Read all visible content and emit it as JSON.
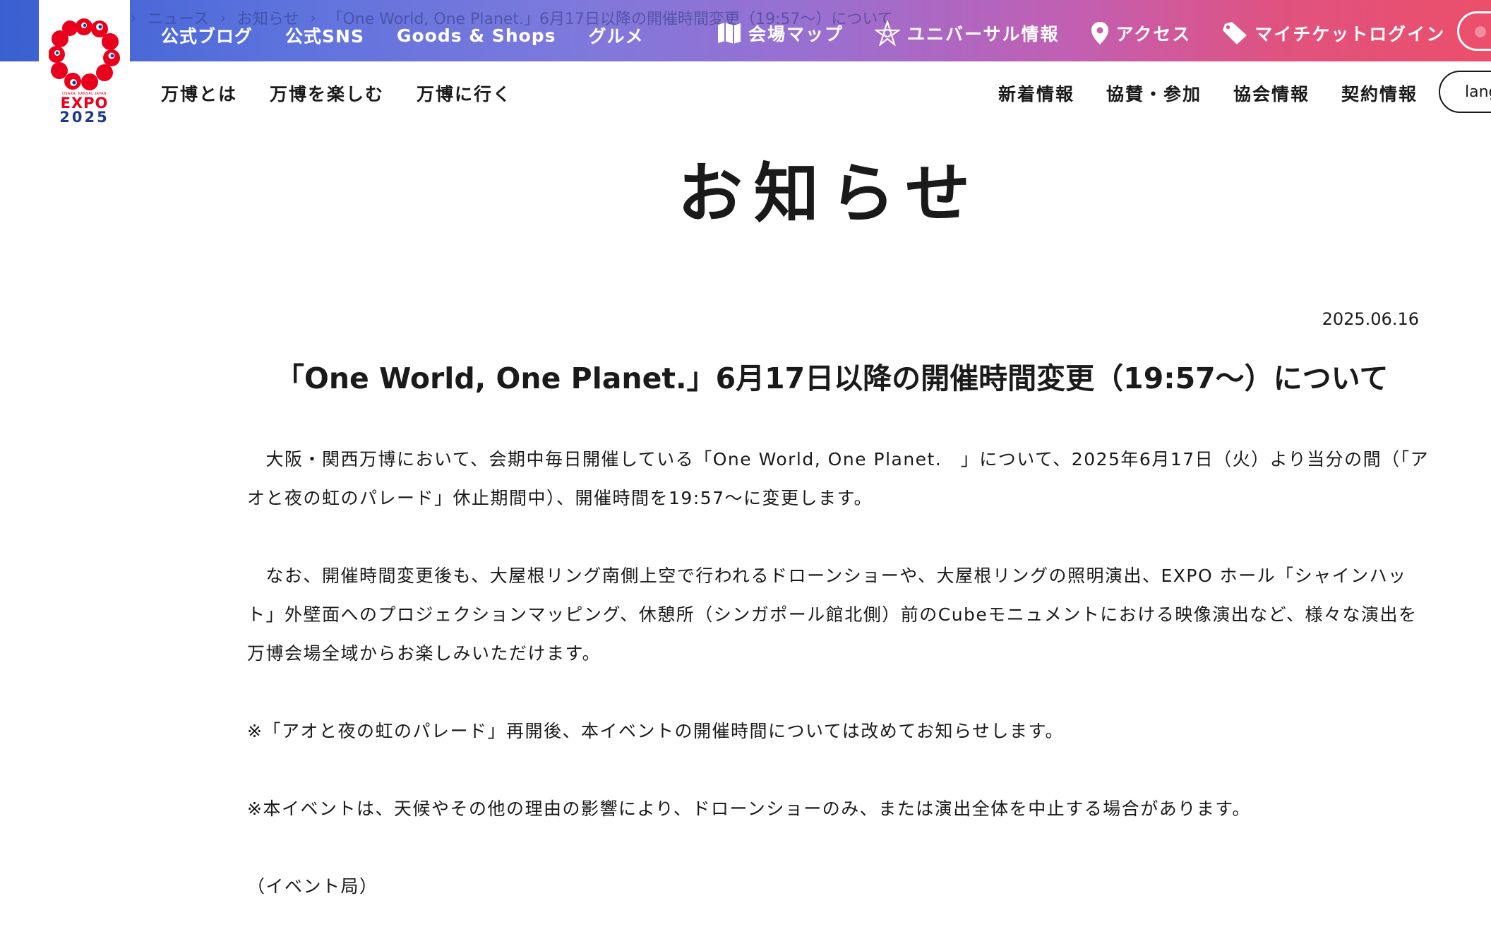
{
  "breadcrumb": {
    "items": [
      "ニュース",
      "お知らせ",
      "「One World, One Planet.」6月17日以降の開催時間変更（19:57〜）について"
    ]
  },
  "topnav": {
    "left": [
      "公式ブログ",
      "公式SNS",
      "Goods & Shops",
      "グルメ"
    ],
    "right": [
      {
        "label": "会場マップ",
        "icon": "map-icon"
      },
      {
        "label": "ユニバーサル情報",
        "icon": "universal-icon"
      },
      {
        "label": "アクセス",
        "icon": "location-pin-icon"
      },
      {
        "label": "マイチケットログイン",
        "icon": "ticket-icon"
      }
    ]
  },
  "logo": {
    "text": "EXPO",
    "year": "2025",
    "tiny": "OSAKA, KANSAI, JAPAN"
  },
  "mainnav": {
    "left": [
      "万博とは",
      "万博を楽しむ",
      "万博に行く"
    ],
    "right": [
      "新着情報",
      "協賛・参加",
      "協会情報",
      "契約情報"
    ],
    "lang": "language"
  },
  "page": {
    "title": "お知らせ"
  },
  "article": {
    "date": "2025.06.16",
    "title": "「One World, One Planet.」6月17日以降の開催時間変更（19:57〜）について",
    "paragraphs": [
      "　大阪・関西万博において、会期中毎日開催している「One World, One Planet.　」について、2025年6月17日（火）より当分の間（「アオと夜の虹のパレード」休止期間中）、開催時間を19:57〜に変更します。",
      "　なお、開催時間変更後も、大屋根リング南側上空で行われるドローンショーや、大屋根リングの照明演出、EXPO ホール「シャインハット」外壁面へのプロジェクションマッピング、休憩所（シンガポール館北側）前のCubeモニュメントにおける映像演出など、様々な演出を万博会場全域からお楽しみいただけます。",
      "※「アオと夜の虹のパレード」再開後、本イベントの開催時間については改めてお知らせします。",
      "※本イベントは、天候やその他の理由の影響により、ドローンショーのみ、または演出全体を中止する場合があります。",
      "（イベント局）"
    ]
  },
  "colors": {
    "gradient_start": "#3a5fd0",
    "gradient_end": "#ec4f6a",
    "logo_red": "#e8001c",
    "logo_blue": "#1b3a8f"
  }
}
